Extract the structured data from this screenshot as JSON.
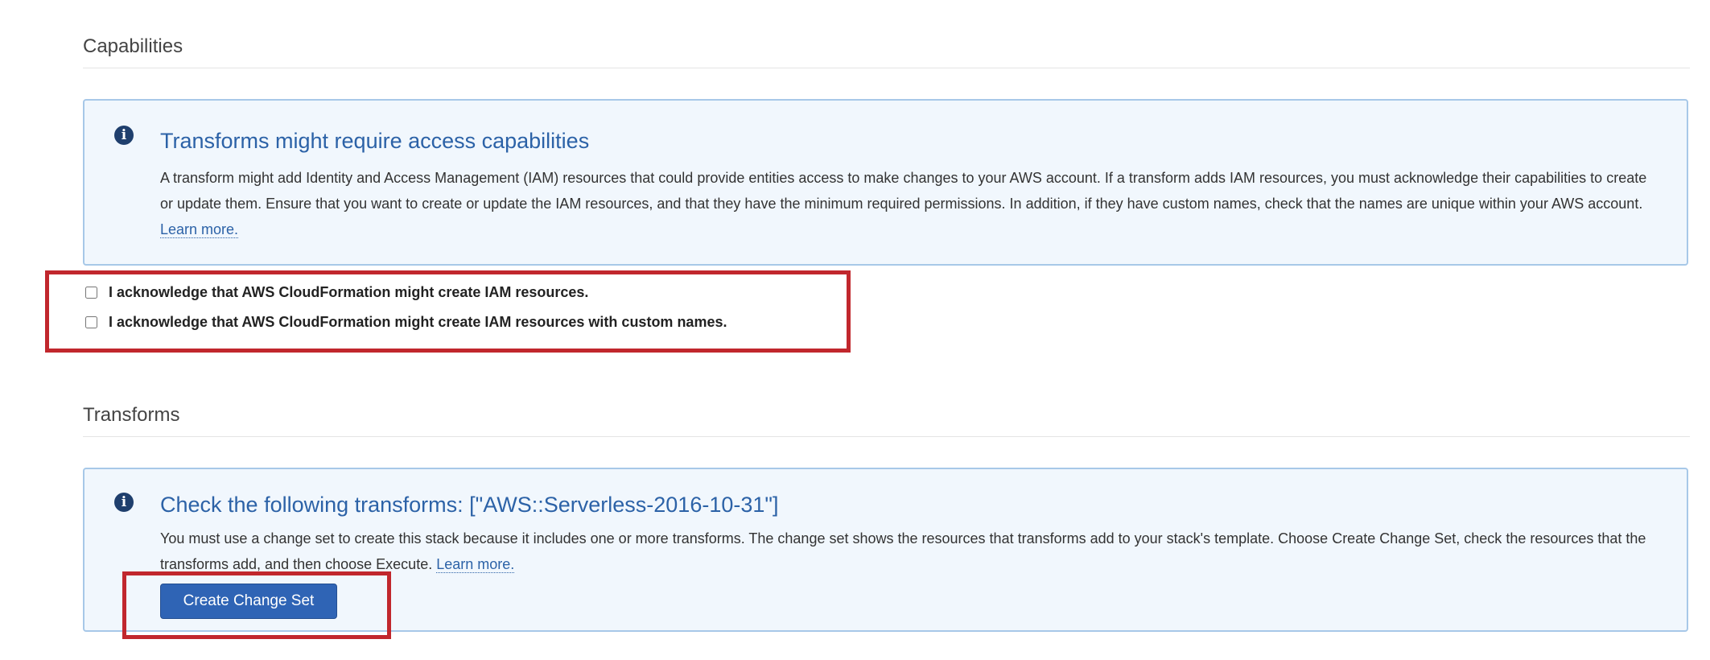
{
  "capabilities": {
    "heading": "Capabilities",
    "info_box": {
      "icon": "info-icon",
      "title": "Transforms might require access capabilities",
      "body": "A transform might add Identity and Access Management (IAM) resources that could provide entities access to make changes to your AWS account. If a transform adds IAM resources, you must acknowledge their capabilities to create or update them. Ensure that you want to create or update the IAM resources, and that they have the minimum required permissions. In addition, if they have custom names, check that the names are unique within your AWS account.",
      "link_label": "Learn more."
    },
    "acknowledgements": [
      {
        "label": "I acknowledge that AWS CloudFormation might create IAM resources.",
        "checked": false
      },
      {
        "label": "I acknowledge that AWS CloudFormation might create IAM resources with custom names.",
        "checked": false
      }
    ]
  },
  "transforms": {
    "heading": "Transforms",
    "info_box": {
      "icon": "info-icon",
      "title": "Check the following transforms: [\"AWS::Serverless-2016-10-31\"]",
      "body": "You must use a change set to create this stack because it includes one or more transforms. The change set shows the resources that transforms add to your stack's template. Choose Create Change Set, check the resources that the transforms add, and then choose Execute.",
      "link_label": "Learn more.",
      "button_label": "Create Change Set"
    }
  },
  "colors": {
    "accent_blue": "#2c62a7",
    "info_bg": "#f1f7fd",
    "info_border": "#a7c8e8",
    "button_bg": "#2f64b5",
    "highlight_red": "#c1272d"
  }
}
